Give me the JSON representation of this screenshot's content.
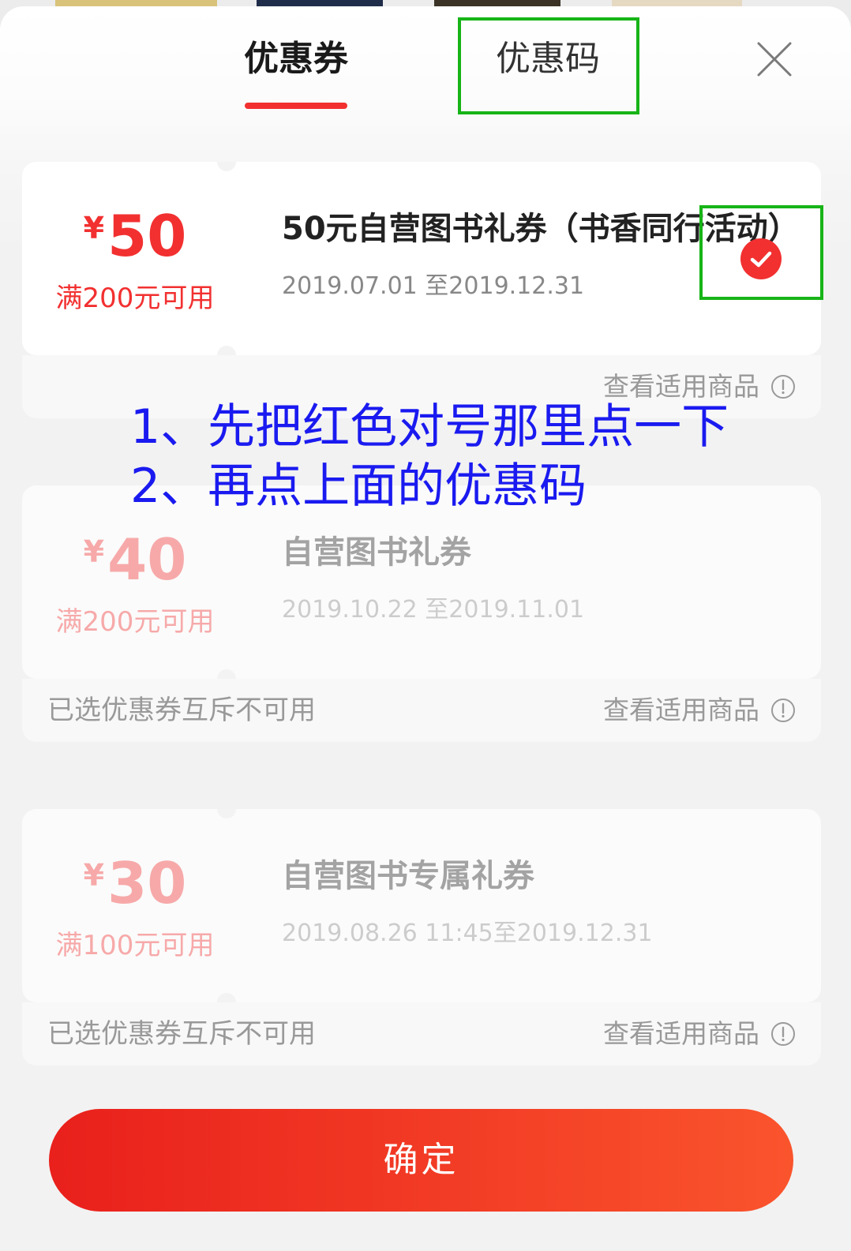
{
  "header": {
    "tabs": [
      {
        "label": "优惠券",
        "active": true
      },
      {
        "label": "优惠码",
        "active": false
      }
    ]
  },
  "icons": {
    "close": "close-icon",
    "info": "info-circle-icon",
    "selected": "check-circle-icon"
  },
  "coupons": [
    {
      "currency": "¥",
      "amount": "50",
      "condition": "满200元可用",
      "title": "50元自营图书礼券（书香同行活动）",
      "validity": "2019.07.01 至2019.12.31",
      "selected": true,
      "available": true,
      "unavailable_note": "",
      "view_products_label": "查看适用商品"
    },
    {
      "currency": "¥",
      "amount": "40",
      "condition": "满200元可用",
      "title": "自营图书礼券",
      "validity": "2019.10.22 至2019.11.01",
      "selected": false,
      "available": false,
      "unavailable_note": "已选优惠券互斥不可用",
      "view_products_label": "查看适用商品"
    },
    {
      "currency": "¥",
      "amount": "30",
      "condition": "满100元可用",
      "title": "自营图书专属礼券",
      "validity": "2019.08.26 11:45至2019.12.31",
      "selected": false,
      "available": false,
      "unavailable_note": "已选优惠券互斥不可用",
      "view_products_label": "查看适用商品"
    }
  ],
  "annotation": {
    "line_1": "1、先把红色对号那里点一下",
    "line_2": "2、再点上面的优惠码",
    "text_color": "#1a1af0",
    "box_color": "#17b417"
  },
  "footer": {
    "confirm_label": "确定"
  },
  "colors": {
    "accent": "#f23030",
    "button_gradient_start": "#e9201c",
    "button_gradient_end": "#fa542d",
    "muted_text": "#999999"
  }
}
